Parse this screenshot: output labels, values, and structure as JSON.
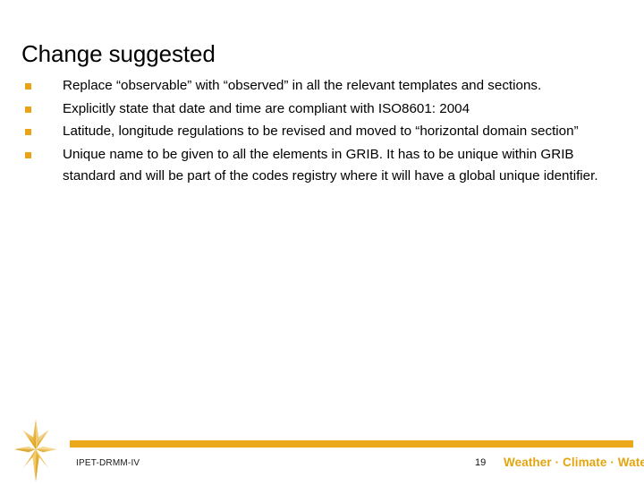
{
  "slide": {
    "title": "Change suggested",
    "background_color": "#ffffff",
    "accent_color": "#E8A317",
    "bar_color": "#ECA81B",
    "bullets": [
      {
        "marker": "square-bullet",
        "text": "Replace “observable” with “observed” in all the relevant templates and sections."
      },
      {
        "marker": "square-bullet",
        "text": "Explicitly state that date and time are compliant with ISO8601: 2004"
      },
      {
        "marker": "square-bullet",
        "text": "Latitude, longitude regulations to be revised and moved to “horizontal domain section”"
      },
      {
        "marker": "square-bullet",
        "text": "Unique name to be given to all the elements in GRIB. It has to be unique within GRIB standard and will be part of the codes registry where it will have a global unique identifier."
      }
    ]
  },
  "footer": {
    "logo_icon": "compass-rose-icon",
    "left_label": "IPET-DRMM-IV",
    "page_number": "19",
    "tagline": "Weather · Climate · Water",
    "tagline_color": "#E3A410"
  }
}
